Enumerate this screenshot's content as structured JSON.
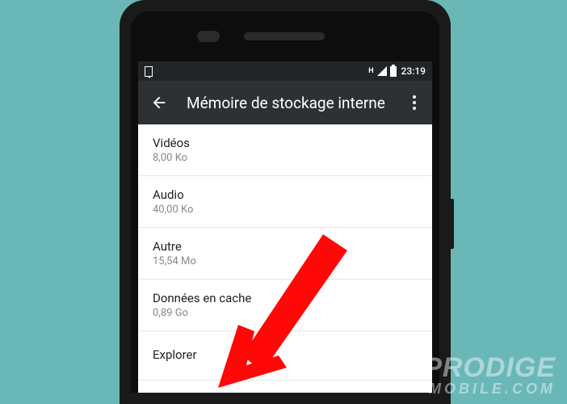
{
  "status": {
    "signal_label": "H",
    "time": "23:19"
  },
  "appbar": {
    "title": "Mémoire de stockage interne"
  },
  "items": [
    {
      "title": "Vidéos",
      "sub": "8,00 Ko"
    },
    {
      "title": "Audio",
      "sub": "40,00 Ko"
    },
    {
      "title": "Autre",
      "sub": "15,54 Mo"
    },
    {
      "title": "Données en cache",
      "sub": "0,89 Go"
    },
    {
      "title": "Explorer",
      "sub": ""
    }
  ],
  "watermark": {
    "line1": "PRODIGE",
    "line2": "MOBILE.COM"
  }
}
